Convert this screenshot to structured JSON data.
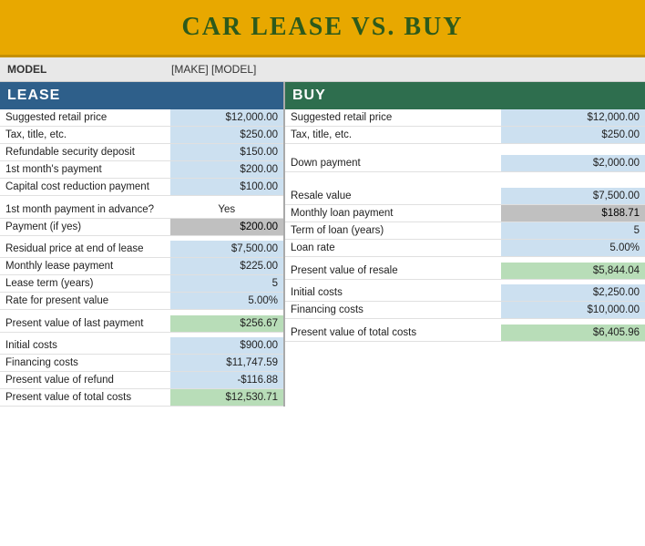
{
  "title": "CAR LEASE VS. BUY",
  "model": {
    "label": "MODEL",
    "value": "[MAKE] [MODEL]"
  },
  "lease": {
    "header": "LEASE",
    "rows": [
      {
        "label": "Suggested retail price",
        "value": "$12,000.00",
        "style": "light-blue"
      },
      {
        "label": "Tax, title, etc.",
        "value": "$250.00",
        "style": "light-blue"
      },
      {
        "label": "Refundable security deposit",
        "value": "$150.00",
        "style": "light-blue"
      },
      {
        "label": "1st month's payment",
        "value": "$200.00",
        "style": "light-blue"
      },
      {
        "label": "Capital cost reduction payment",
        "value": "$100.00",
        "style": "light-blue"
      },
      {
        "label": "spacer",
        "value": "",
        "style": "spacer"
      },
      {
        "label": "1st month payment in advance?",
        "value": "Yes",
        "style": "white"
      },
      {
        "label": "Payment (if yes)",
        "value": "$200.00",
        "style": "grey"
      },
      {
        "label": "spacer",
        "value": "",
        "style": "spacer"
      },
      {
        "label": "Residual price at end of lease",
        "value": "$7,500.00",
        "style": "light-blue"
      },
      {
        "label": "Monthly lease payment",
        "value": "$225.00",
        "style": "light-blue"
      },
      {
        "label": "Lease term (years)",
        "value": "5",
        "style": "light-blue"
      },
      {
        "label": "Rate for present value",
        "value": "5.00%",
        "style": "light-blue"
      },
      {
        "label": "spacer",
        "value": "",
        "style": "spacer"
      },
      {
        "label": "Present value of last payment",
        "value": "$256.67",
        "style": "green"
      },
      {
        "label": "spacer",
        "value": "",
        "style": "spacer"
      },
      {
        "label": "Initial costs",
        "value": "$900.00",
        "style": "light-blue"
      },
      {
        "label": "Financing costs",
        "value": "$11,747.59",
        "style": "light-blue"
      },
      {
        "label": "Present value of refund",
        "value": "-$116.88",
        "style": "light-blue"
      },
      {
        "label": "Present value of total costs",
        "value": "$12,530.71",
        "style": "green"
      }
    ]
  },
  "buy": {
    "header": "BUY",
    "rows": [
      {
        "label": "Suggested retail price",
        "value": "$12,000.00",
        "style": "light-blue"
      },
      {
        "label": "Tax, title, etc.",
        "value": "$250.00",
        "style": "light-blue"
      },
      {
        "label": "spacer2",
        "value": "",
        "style": "spacer"
      },
      {
        "label": "spacer3",
        "value": "",
        "style": "spacer"
      },
      {
        "label": "Down payment",
        "value": "$2,000.00",
        "style": "light-blue"
      },
      {
        "label": "spacer4",
        "value": "",
        "style": "spacer"
      },
      {
        "label": "spacer5",
        "value": "",
        "style": "spacer"
      },
      {
        "label": "spacer6",
        "value": "",
        "style": "spacer"
      },
      {
        "label": "Resale value",
        "value": "$7,500.00",
        "style": "light-blue"
      },
      {
        "label": "Monthly loan payment",
        "value": "$188.71",
        "style": "grey"
      },
      {
        "label": "Term of loan (years)",
        "value": "5",
        "style": "light-blue"
      },
      {
        "label": "Loan rate",
        "value": "5.00%",
        "style": "light-blue"
      },
      {
        "label": "spacer7",
        "value": "",
        "style": "spacer"
      },
      {
        "label": "Present value of resale",
        "value": "$5,844.04",
        "style": "green"
      },
      {
        "label": "spacer8",
        "value": "",
        "style": "spacer"
      },
      {
        "label": "Initial costs",
        "value": "$2,250.00",
        "style": "light-blue"
      },
      {
        "label": "Financing costs",
        "value": "$10,000.00",
        "style": "light-blue"
      },
      {
        "label": "spacer9",
        "value": "",
        "style": "spacer"
      },
      {
        "label": "Present value of total costs",
        "value": "$6,405.96",
        "style": "green"
      }
    ]
  }
}
